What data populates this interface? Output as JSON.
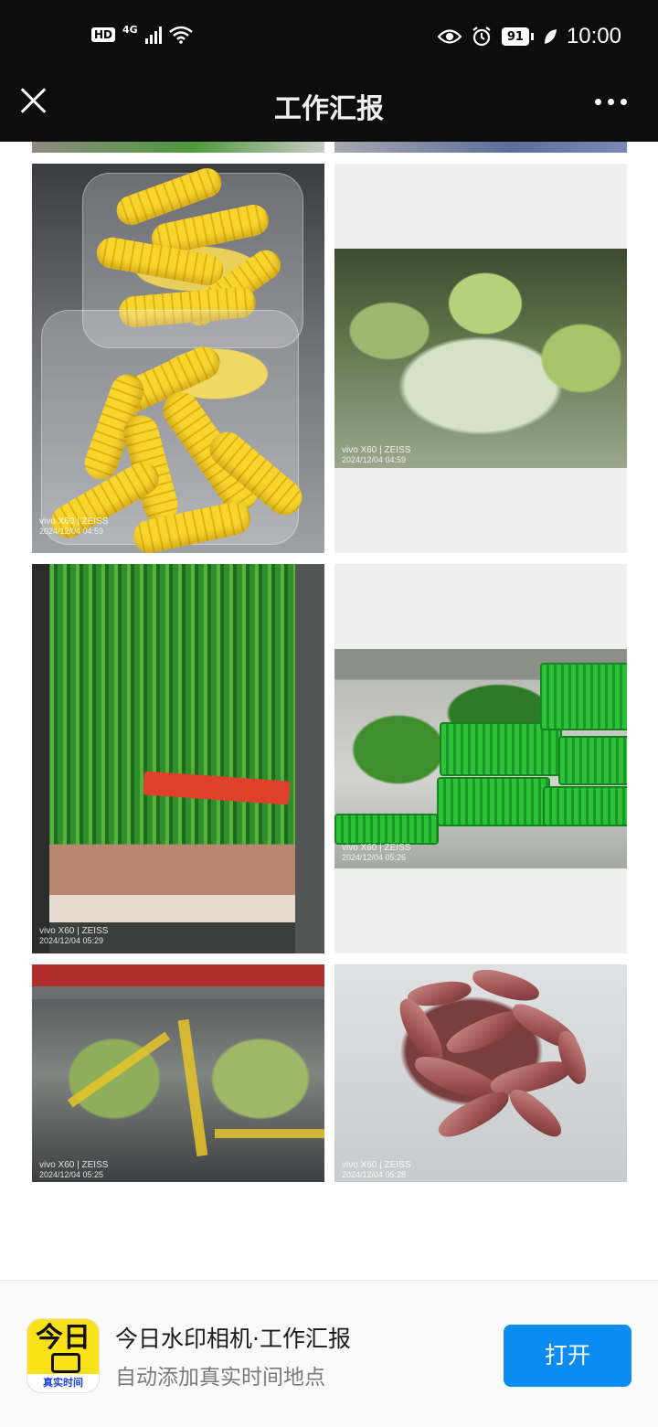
{
  "status_bar": {
    "hd": "HD",
    "network": "4G",
    "battery": "91",
    "time": "10:00",
    "icons": [
      "wifi-icon",
      "eye-icon",
      "alarm-icon",
      "leaf-icon"
    ]
  },
  "header": {
    "title": "工作汇报",
    "close_icon": "close-icon",
    "more_icon": "more-icon"
  },
  "photos": [
    {
      "subject": "corn",
      "watermark_brand": "vivo X60 | ZEISS",
      "watermark_time": "2024/12/04 04:59"
    },
    {
      "subject": "lettuce",
      "watermark_brand": "vivo X60 | ZEISS",
      "watermark_time": "2024/12/04 04:59"
    },
    {
      "subject": "scallions",
      "watermark_brand": "vivo X60 | ZEISS",
      "watermark_time": "2024/12/04 05:29"
    },
    {
      "subject": "leafy-greens",
      "watermark_brand": "vivo X60 | ZEISS",
      "watermark_time": "2024/12/04 05:26"
    },
    {
      "subject": "bok-choy",
      "watermark_brand": "vivo X60 | ZEISS",
      "watermark_time": "2024/12/04 05:25"
    },
    {
      "subject": "sweet-potatoes",
      "watermark_brand": "vivo X60 | ZEISS",
      "watermark_time": "2024/12/04 05:28"
    }
  ],
  "banner": {
    "app_icon_text": "今日",
    "app_icon_strip": "真实时间",
    "app_name": "今日水印相机·工作汇报",
    "app_desc": "自动添加真实时间地点",
    "open_label": "打开",
    "accent": "#0b8cf3"
  }
}
